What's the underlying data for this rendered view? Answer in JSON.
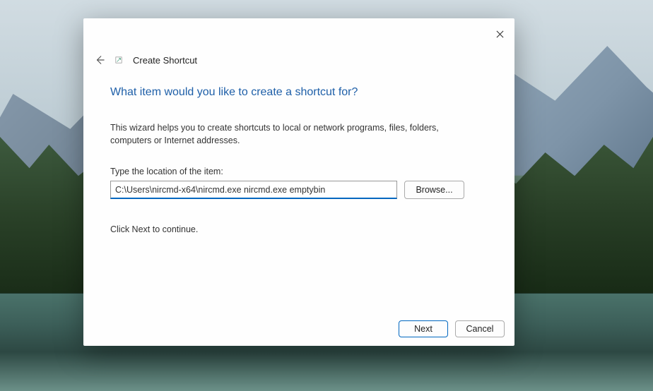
{
  "wizard": {
    "title": "Create Shortcut",
    "heading": "What item would you like to create a shortcut for?",
    "description": "This wizard helps you to create shortcuts to local or network programs, files, folders, computers or Internet addresses.",
    "location_label": "Type the location of the item:",
    "location_value": "C:\\Users\\nircmd-x64\\nircmd.exe nircmd.exe emptybin",
    "browse_label": "Browse...",
    "continue_hint": "Click Next to continue."
  },
  "footer": {
    "next_label": "Next",
    "cancel_label": "Cancel"
  },
  "colors": {
    "accent": "#0067c0",
    "heading": "#1e5fa8"
  }
}
